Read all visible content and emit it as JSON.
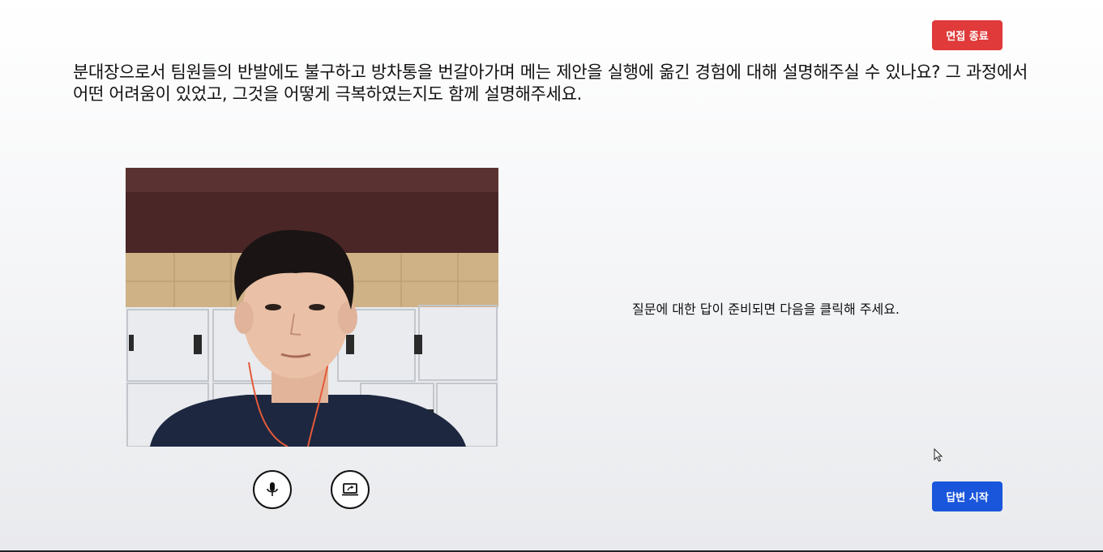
{
  "header": {
    "end_interview_label": "면접 종료"
  },
  "question": {
    "text": "분대장으로서 팀원들의 반발에도 불구하고 방차통을 번갈아가며 메는 제안을 실행에 옮긴 경험에 대해 설명해주실 수 있나요? 그 과정에서 어떤 어려움이 있었고, 그것을 어떻게 극복하였는지도 함께 설명해주세요."
  },
  "main": {
    "instruction": "질문에 대한 답이 준비되면 다음을 클릭해 주세요.",
    "start_answer_label": "답변 시작"
  },
  "controls": {
    "mic_icon": "microphone-icon",
    "screen_icon": "screen-share-icon"
  },
  "colors": {
    "end_button": "#e03a3a",
    "start_button": "#1a56db"
  }
}
